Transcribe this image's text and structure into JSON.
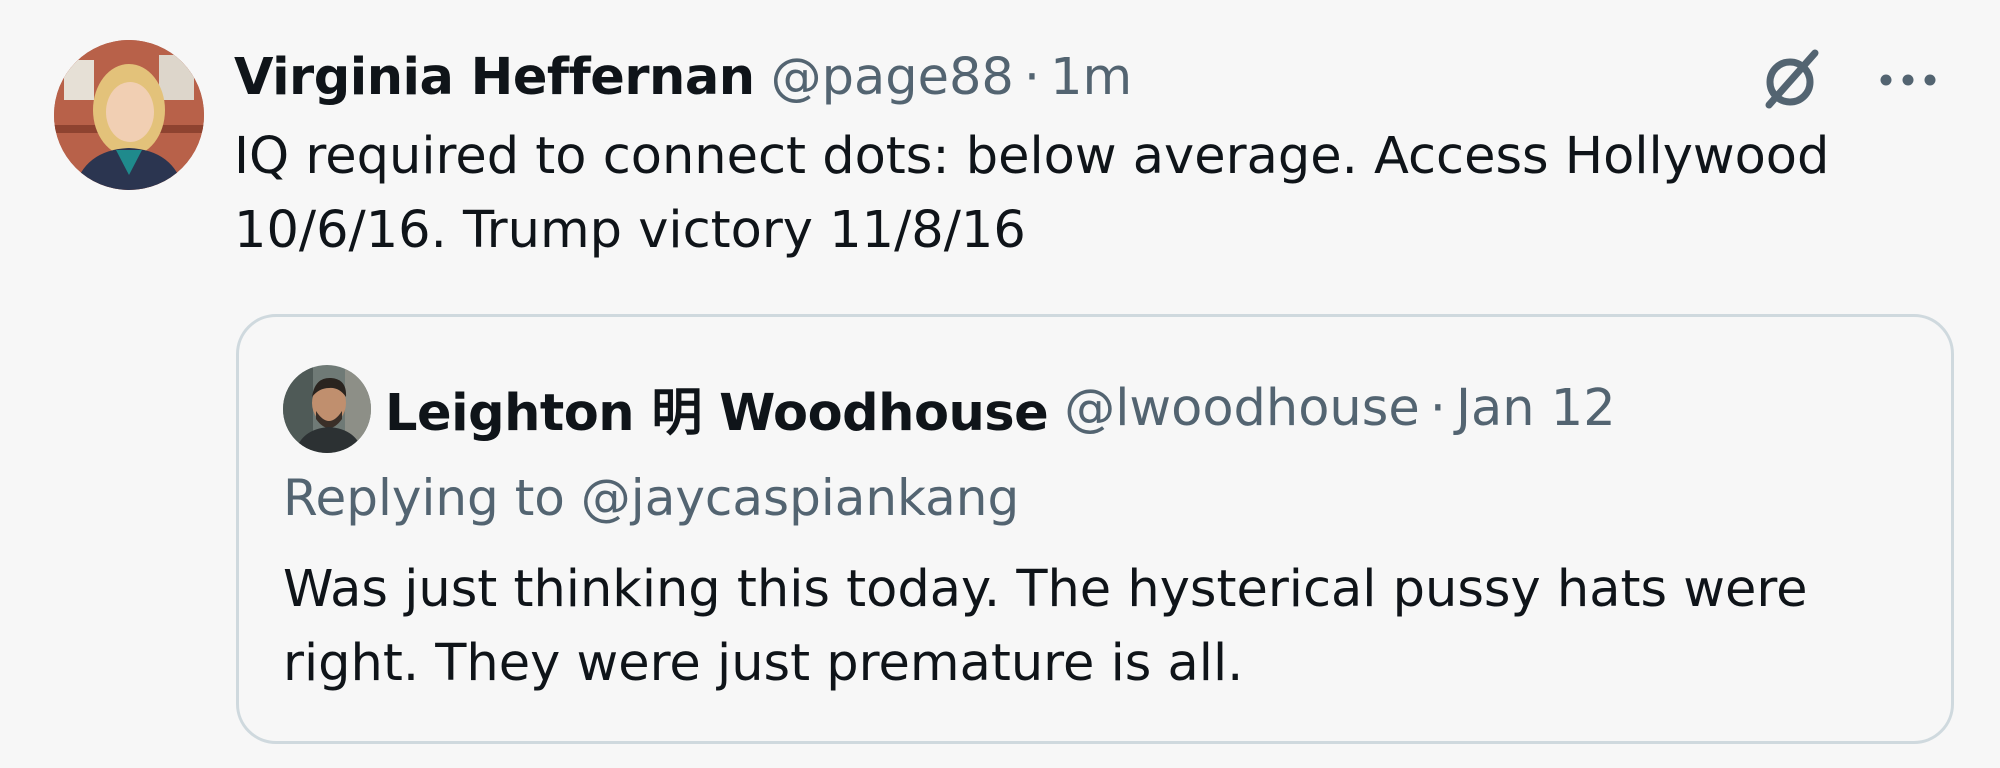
{
  "tweet": {
    "author": {
      "name": "Virginia Heffernan",
      "handle": "@page88",
      "separator": "·",
      "time": "1m"
    },
    "text_line1": "IQ required to connect dots: below average. Access Hollywood",
    "text_line2": "10/6/16. Trump victory 11/8/16",
    "icons": {
      "grok": "slashed-circle-icon",
      "more": "more-horizontal-icon"
    }
  },
  "quoted": {
    "author": {
      "name": "Leighton 明 Woodhouse",
      "handle": "@lwoodhouse",
      "separator": "·",
      "time": "Jan 12"
    },
    "replying_prefix": "Replying to",
    "replying_to": "@jaycaspiankang",
    "text_line1": "Was just thinking this today. The hysterical pussy hats were",
    "text_line2": "right. They were just premature is all."
  },
  "colors": {
    "background": "#f7f7f7",
    "primary_text": "#0f1419",
    "secondary_text": "#536471",
    "border": "#cfd9de"
  }
}
